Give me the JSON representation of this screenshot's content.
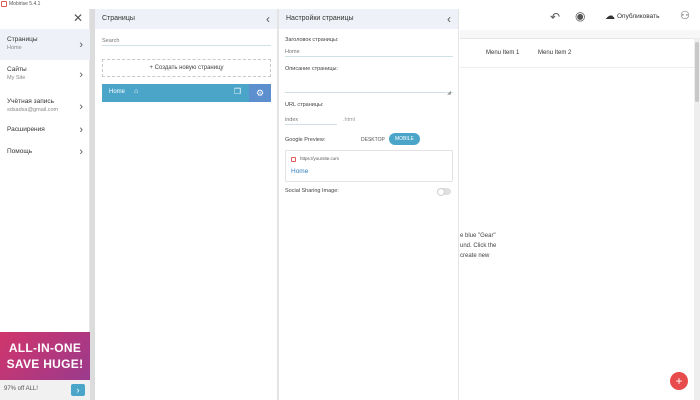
{
  "window": {
    "title": "Mobirise 5.4.1"
  },
  "sidebar": {
    "items": [
      {
        "label": "Страницы",
        "sub": "Home"
      },
      {
        "label": "Сайты",
        "sub": "My Site"
      },
      {
        "label": "Учётная запись",
        "sub": "sdsadsa@gmail.com"
      },
      {
        "label": "Расширения",
        "sub": ""
      },
      {
        "label": "Помощь",
        "sub": ""
      }
    ],
    "promo": {
      "line1": "ALL-IN-ONE",
      "line2": "SAVE HUGE!",
      "offer": "97% off ALL!"
    }
  },
  "pages_panel": {
    "title": "Страницы",
    "search_placeholder": "Search",
    "create_label": "+ Создать новую страницу",
    "pages": [
      {
        "name": "Home"
      }
    ]
  },
  "settings_panel": {
    "title": "Настройки страницы",
    "page_title_label": "Заголовок страницы:",
    "page_title_value": "Home",
    "description_label": "Описание страницы:",
    "description_value": "",
    "url_label": "URL страницы:",
    "url_value": "index",
    "url_ext": ".html",
    "google_preview_label": "Google Preview:",
    "tab_desktop": "DESKTOP",
    "tab_mobile": "MOBILE",
    "preview_url": "https://yoursite.com",
    "preview_title": "Home",
    "social_label": "Social Sharing Image:"
  },
  "toolbar": {
    "publish_label": "Опубликовать"
  },
  "site": {
    "menu_items": [
      "Menu Item 1",
      "Menu Item 2"
    ],
    "hint_lines": [
      "e blue \"Gear\"",
      "und. Click the",
      "create new"
    ]
  },
  "colors": {
    "accent": "#4aa5c9",
    "gear": "#5d8fce",
    "fab": "#e84b4b"
  }
}
